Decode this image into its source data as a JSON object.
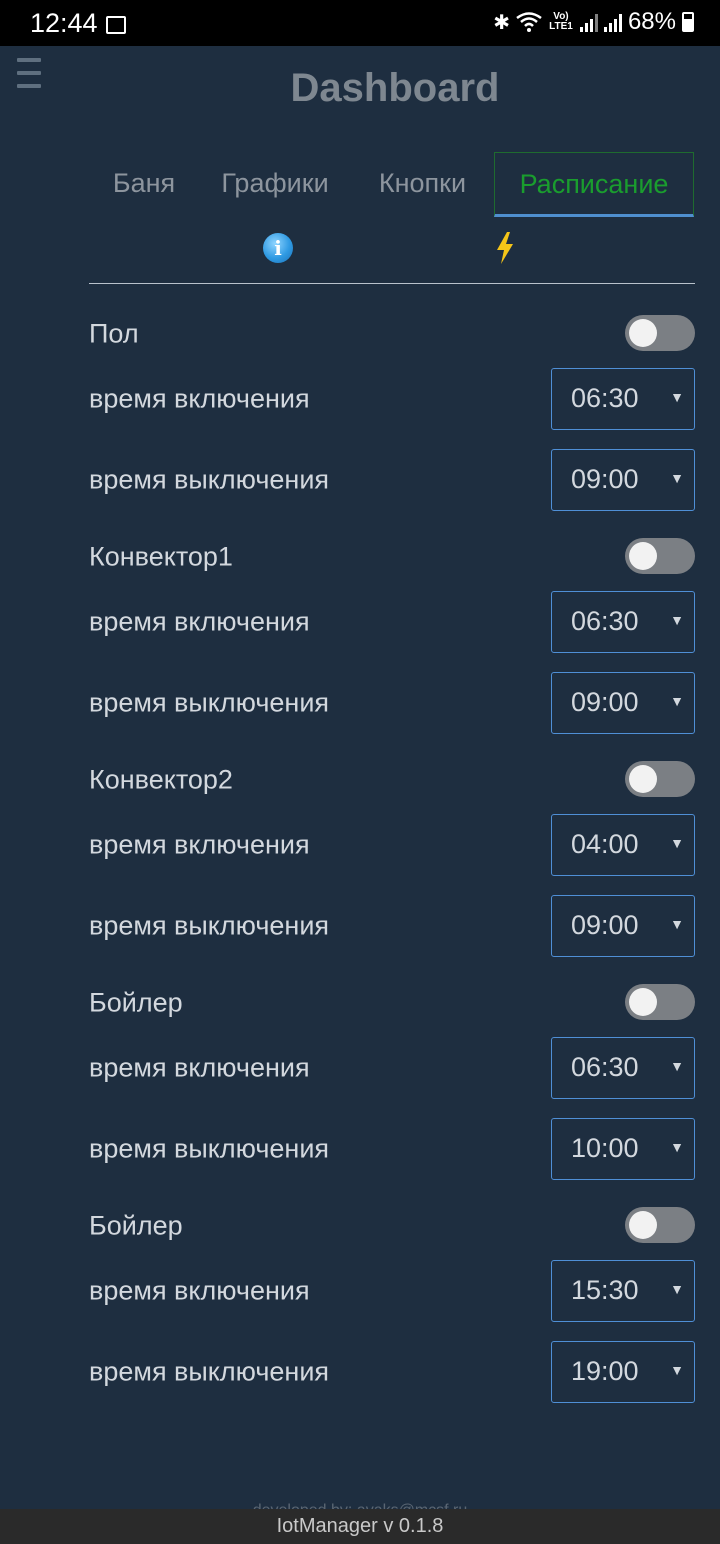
{
  "status_bar": {
    "time": "12:44",
    "lte_label": "Vo) LTE1",
    "battery": "68%"
  },
  "header": {
    "title": "Dashboard",
    "menu_icon": "hamburger-menu-icon"
  },
  "tabs": [
    {
      "label": "Баня",
      "active": false
    },
    {
      "label": "Графики",
      "active": false
    },
    {
      "label": "Кнопки",
      "active": false
    },
    {
      "label": "Расписание",
      "active": true
    }
  ],
  "icon_row": {
    "info_icon": "info-icon",
    "bolt_icon": "lightning-bolt-icon"
  },
  "groups": [
    {
      "title": "Пол",
      "enabled": false,
      "on_label": "время включения",
      "on_time": "06:30",
      "off_label": "время выключения",
      "off_time": "09:00"
    },
    {
      "title": "Конвектор1",
      "enabled": false,
      "on_label": "время включения",
      "on_time": "06:30",
      "off_label": "время выключения",
      "off_time": "09:00"
    },
    {
      "title": "Конвектор2",
      "enabled": false,
      "on_label": "время включения",
      "on_time": "04:00",
      "off_label": "время выключения",
      "off_time": "09:00"
    },
    {
      "title": "Бойлер",
      "enabled": false,
      "on_label": "время включения",
      "on_time": "06:30",
      "off_label": "время выключения",
      "off_time": "10:00"
    },
    {
      "title": "Бойлер",
      "enabled": false,
      "on_label": "время включения",
      "on_time": "15:30",
      "off_label": "время выключения",
      "off_time": "19:00"
    }
  ],
  "footer": {
    "developer": "developed by: avaks@mcsf.ru",
    "version": "IotManager v 0.1.8"
  },
  "colors": {
    "background": "#1e2e40",
    "active_tab_text": "#1a9d2e",
    "select_border": "#4f8fd6",
    "toggle_off": "#7b7f84"
  }
}
